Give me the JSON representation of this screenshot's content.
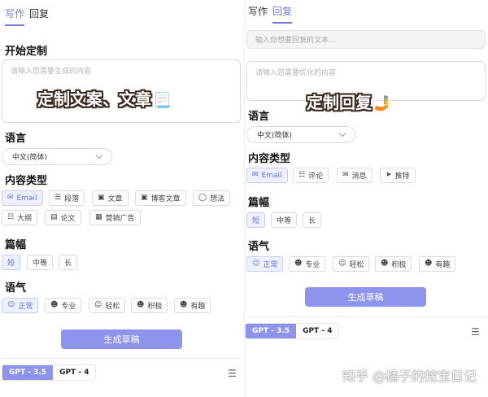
{
  "left": {
    "tabs": [
      "写作",
      "回复"
    ],
    "start_title": "开始定制",
    "input_placeholder": "请输入您需要生成的内容",
    "overlay_text": "定制文案、文章",
    "overlay_emoji": "📃",
    "language_label": "语言",
    "language_value": "中文(简体)",
    "content_type_label": "内容类型",
    "content_types": [
      "Email",
      "段落",
      "文章",
      "博客文章",
      "想法",
      "大纲",
      "论文",
      "营销广告"
    ],
    "length_label": "篇幅",
    "lengths": [
      "短",
      "中等",
      "长"
    ],
    "tone_label": "语气",
    "tones": [
      "正常",
      "专业",
      "轻松",
      "积极",
      "有趣"
    ],
    "generate_label": "生成草稿",
    "models": [
      "GPT - 3.5",
      "GPT - 4"
    ]
  },
  "right": {
    "tabs": [
      "写作",
      "回复"
    ],
    "reply_placeholder": "输入你想要回复的文本...",
    "optimize_placeholder": "请输入您需要优化的内容",
    "overlay_text": "定制回复",
    "overlay_emoji": "🤳",
    "language_label": "语言",
    "language_value": "中文(简体)",
    "content_type_label": "内容类型",
    "content_types": [
      "Email",
      "评论",
      "消息",
      "推特"
    ],
    "length_label": "篇幅",
    "lengths": [
      "短",
      "中等",
      "长"
    ],
    "tone_label": "语气",
    "tones": [
      "正常",
      "专业",
      "轻松",
      "积极",
      "有趣"
    ],
    "generate_label": "生成草稿",
    "models": [
      "GPT - 3.5",
      "GPT - 4"
    ]
  },
  "watermark": "知乎 @橘子的挖宝日记",
  "colors": {
    "accent": "#6f7ce6",
    "button": "#8e93ee",
    "chip_active_bg": "#eef0ff"
  }
}
